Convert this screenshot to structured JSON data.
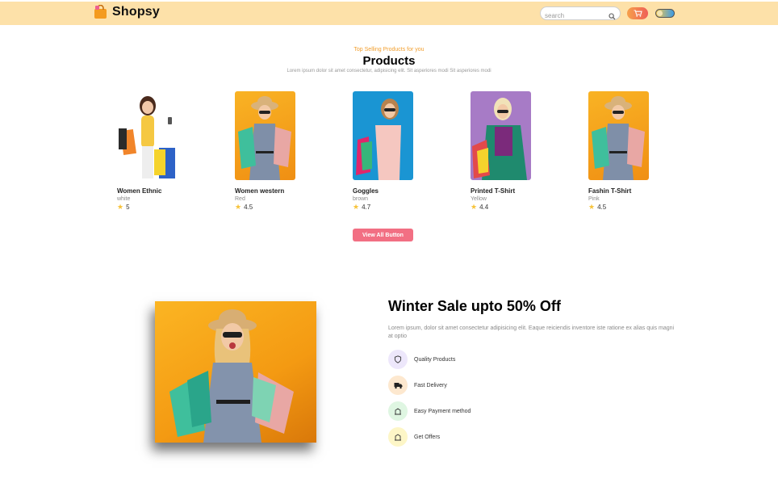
{
  "navbar": {
    "brand": "Shopsy",
    "search_placeholder": "search"
  },
  "products_section": {
    "kicker": "Top Selling Products for you",
    "title": "Products",
    "subtitle": "Lorem ipsum dolor sit amet consectetur, adipisicing elit. Sit asperiores modi Sit asperiores modi",
    "items": [
      {
        "name": "Women Ethnic",
        "color": "white",
        "rating": "5",
        "bg": "#ffffff"
      },
      {
        "name": "Women western",
        "color": "Red",
        "rating": "4.5",
        "bg": "#f7a51b"
      },
      {
        "name": "Goggles",
        "color": "brown",
        "rating": "4.7",
        "bg": "#1a95d3"
      },
      {
        "name": "Printed T-Shirt",
        "color": "Yellow",
        "rating": "4.4",
        "bg": "#a77bc6"
      },
      {
        "name": "Fashin T-Shirt",
        "color": "Pink",
        "rating": "4.5",
        "bg": "#f7a51b"
      }
    ],
    "view_all_label": "View All Button"
  },
  "banner": {
    "title": "Winter Sale upto 50% Off",
    "text": "Lorem ipsum, dolor sit amet consectetur adipisicing elit. Eaque reiciendis inventore iste ratione ex alias quis magni at optio",
    "features": [
      {
        "label": "Quality Products",
        "icon": "shield-icon",
        "bg": "#ede7fb"
      },
      {
        "label": "Fast Delivery",
        "icon": "truck-icon",
        "bg": "#fde8cf"
      },
      {
        "label": "Easy Payment method",
        "icon": "card-icon",
        "bg": "#dff6e2"
      },
      {
        "label": "Get Offers",
        "icon": "gift-icon",
        "bg": "#fdf6c7"
      }
    ]
  },
  "colors": {
    "navbar_bg": "#fde1a9",
    "accent": "#f29f2f",
    "button": "#f26f83"
  }
}
